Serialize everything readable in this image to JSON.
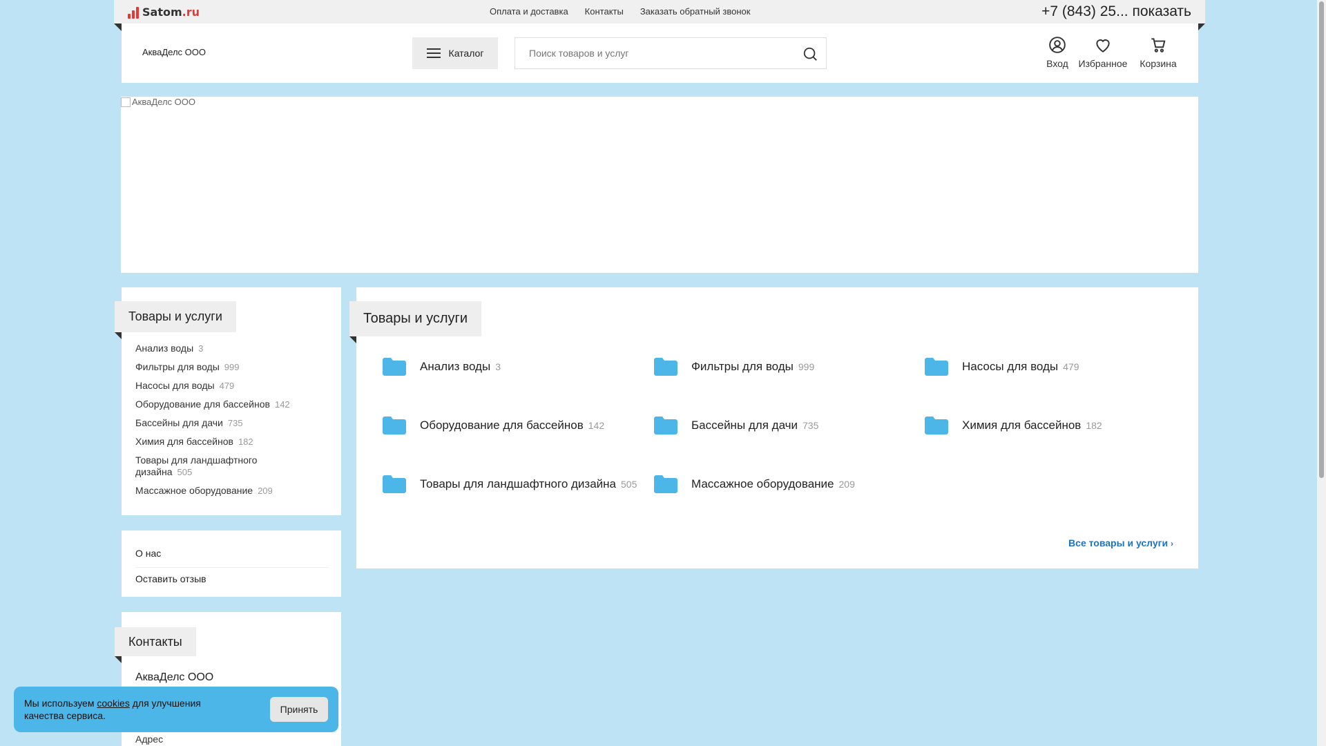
{
  "topbar": {
    "logo_name": "Satom",
    "logo_tld": ".ru",
    "nav": [
      "Оплата и доставка",
      "Контакты",
      "Заказать обратный звонок"
    ],
    "phone": "+7 (843) 25... показать"
  },
  "header": {
    "company": "АкваДелс ООО",
    "catalog_label": "Каталог",
    "search_placeholder": "Поиск товаров и услуг",
    "login_label": "Вход",
    "favorites_label": "Избранное",
    "cart_label": "Корзина"
  },
  "banner": {
    "alt": "АкваДелс ООО"
  },
  "sidebar": {
    "title": "Товары и услуги",
    "items": [
      {
        "label": "Анализ воды",
        "count": "3"
      },
      {
        "label": "Фильтры для воды",
        "count": "999"
      },
      {
        "label": "Насосы для воды",
        "count": "479"
      },
      {
        "label": "Оборудование для бассейнов",
        "count": "142"
      },
      {
        "label": "Бассейны для дачи",
        "count": "735"
      },
      {
        "label": "Химия для бассейнов",
        "count": "182"
      },
      {
        "label": "Товары для ландшафтного дизайна",
        "count": "505"
      },
      {
        "label": "Массажное оборудование",
        "count": "209"
      }
    ],
    "links": [
      "О нас",
      "Оставить отзыв"
    ],
    "contacts_title": "Контакты",
    "contacts_company": "АкваДелс ООО",
    "contacts_address_label": "Адрес"
  },
  "main": {
    "title": "Товары и услуги",
    "categories": [
      {
        "label": "Анализ воды",
        "count": "3"
      },
      {
        "label": "Фильтры для воды",
        "count": "999"
      },
      {
        "label": "Насосы для воды",
        "count": "479"
      },
      {
        "label": "Оборудование для бассейнов",
        "count": "142"
      },
      {
        "label": "Бассейны для дачи",
        "count": "735"
      },
      {
        "label": "Химия для бассейнов",
        "count": "182"
      },
      {
        "label": "Товары для ландшафтного дизайна",
        "count": "505"
      },
      {
        "label": "Массажное оборудование",
        "count": "209"
      }
    ],
    "all_link": "Все товары и услуги"
  },
  "cookie": {
    "text_before": "Мы используем ",
    "link": "cookies",
    "text_after": " для улучшения качества сервиса.",
    "accept": "Принять"
  },
  "colors": {
    "accent": "#4db6e8",
    "link": "#1e73be",
    "background": "#bde3f5",
    "logo_red": "#e53935"
  }
}
